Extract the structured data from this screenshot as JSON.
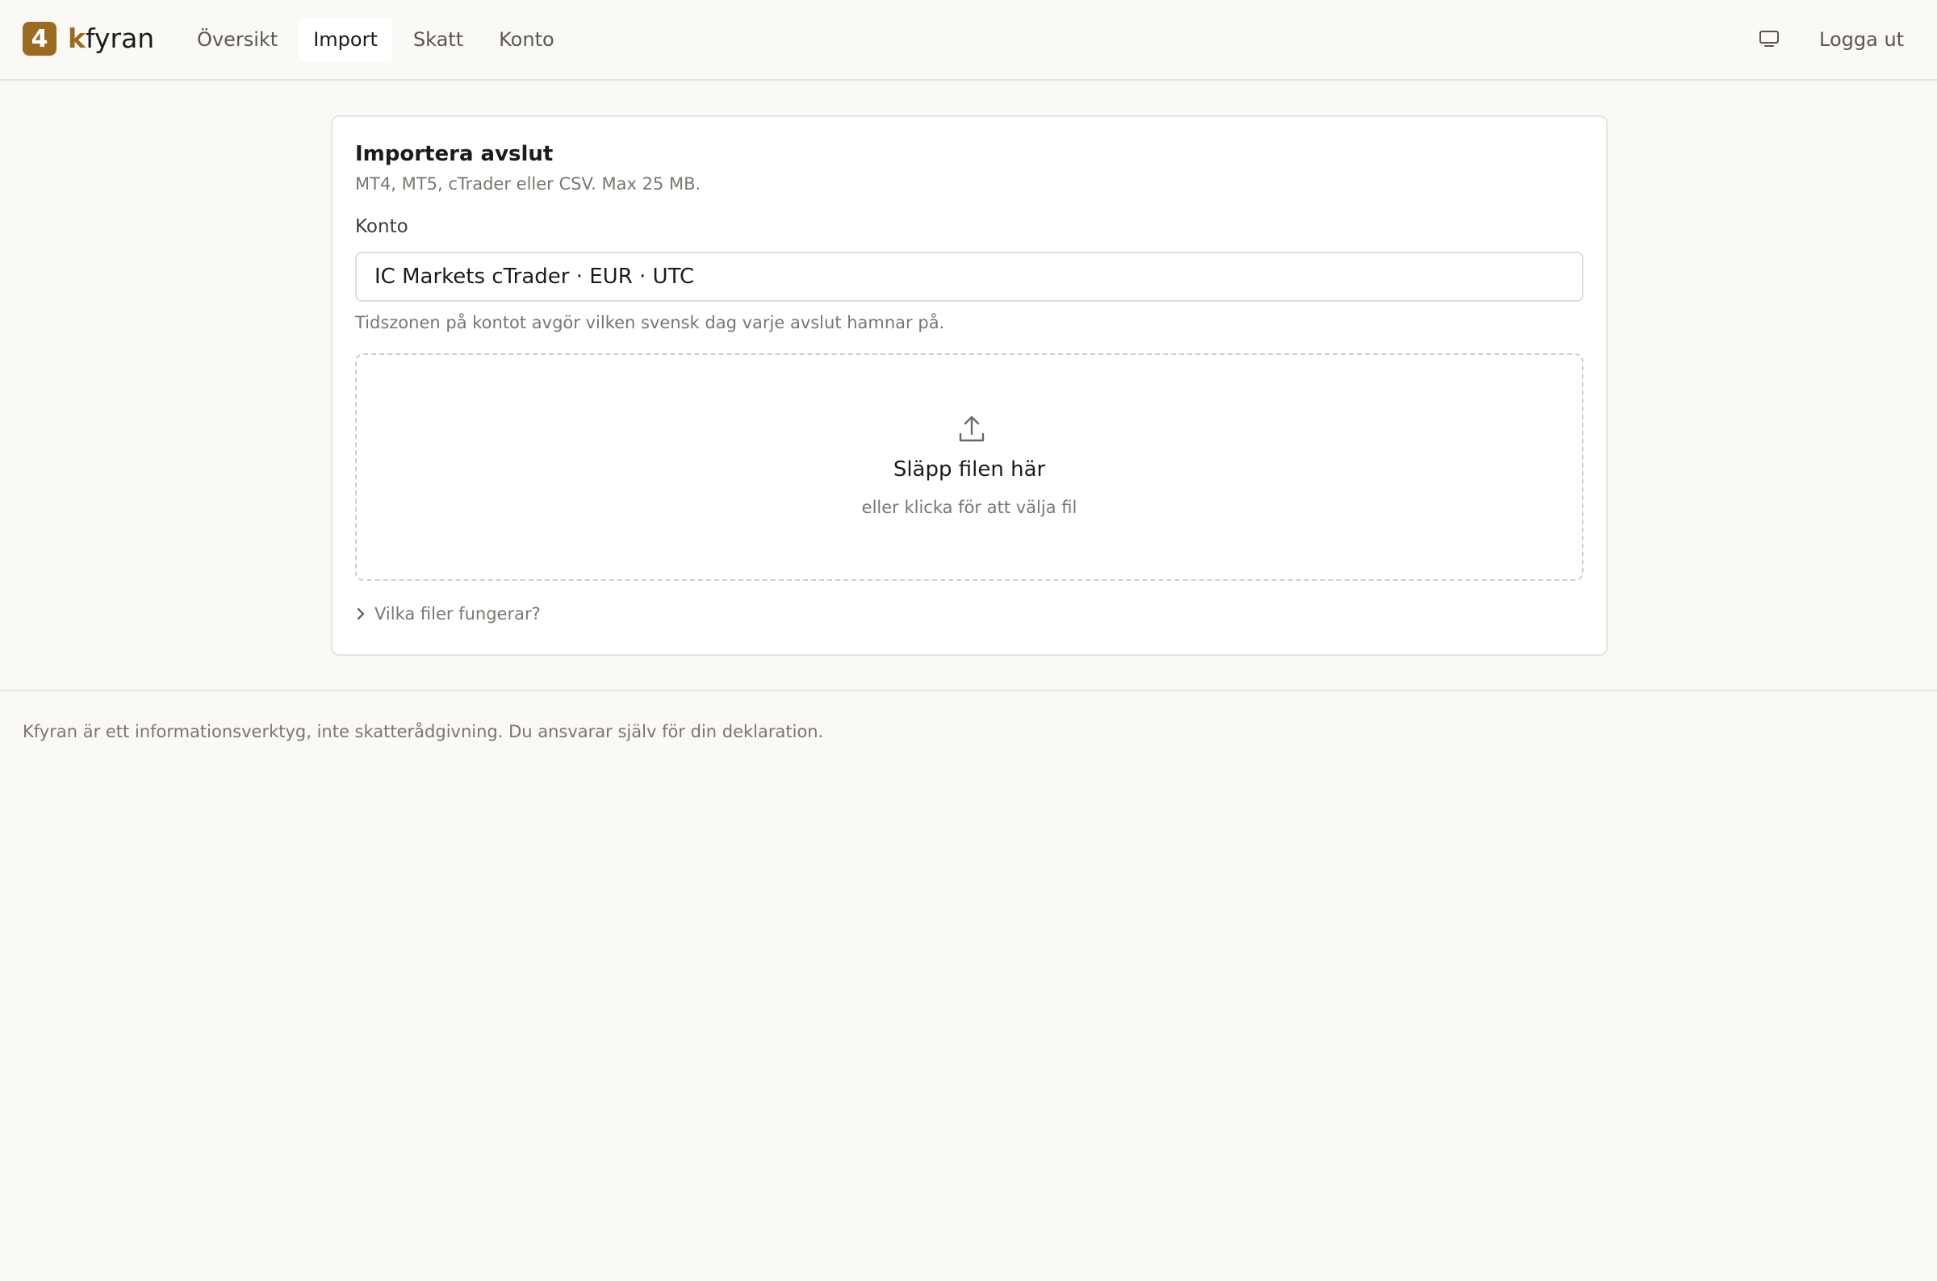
{
  "brand": {
    "badge": "4",
    "name_accent": "k",
    "name_rest": "fyran",
    "accent_color": "#9c6b22"
  },
  "nav": {
    "items": [
      {
        "label": "Översikt",
        "active": false
      },
      {
        "label": "Import",
        "active": true
      },
      {
        "label": "Skatt",
        "active": false
      },
      {
        "label": "Konto",
        "active": false
      }
    ],
    "screen_icon": "monitor-icon",
    "logout_label": "Logga ut"
  },
  "import_card": {
    "title": "Importera avslut",
    "subtitle": "MT4, MT5, cTrader eller CSV. Max 25 MB.",
    "account_label": "Konto",
    "account_value": "IC Markets cTrader · EUR · UTC",
    "timezone_hint": "Tidszonen på kontot avgör vilken svensk dag varje avslut hamnar på.",
    "dropzone": {
      "icon": "upload-icon",
      "title": "Släpp filen här",
      "subtitle": "eller klicka för att välja fil"
    },
    "help_toggle": {
      "icon": "chevron-right-icon",
      "label": "Vilka filer fungerar?"
    }
  },
  "footer": {
    "disclaimer": "Kfyran är ett informationsverktyg, inte skatterådgivning. Du ansvarar själv för din deklaration."
  }
}
